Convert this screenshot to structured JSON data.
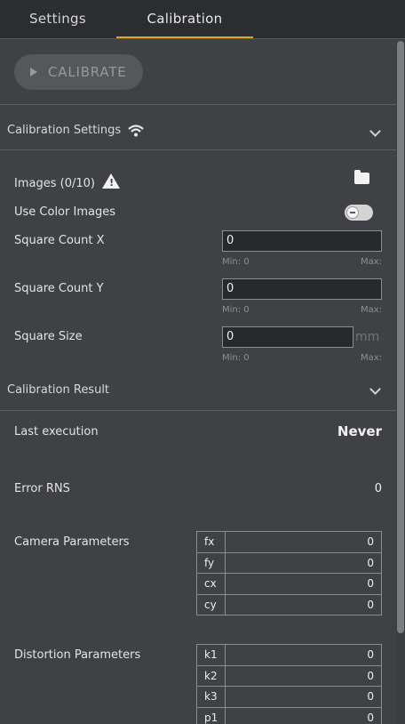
{
  "tabs": [
    {
      "label": "Settings",
      "active": false
    },
    {
      "label": "Calibration",
      "active": true
    }
  ],
  "calibrate_button": {
    "label": "CALIBRATE",
    "enabled": false
  },
  "calibration_settings": {
    "title": "Calibration Settings",
    "images_label": "Images (0/10)",
    "use_color_label": "Use Color Images",
    "use_color_on": false,
    "square_count_x": {
      "label": "Square Count X",
      "value": "0",
      "min": "Min: 0",
      "max": "Max:"
    },
    "square_count_y": {
      "label": "Square Count Y",
      "value": "0",
      "min": "Min: 0",
      "max": "Max:"
    },
    "square_size": {
      "label": "Square Size",
      "value": "0",
      "unit": "mm",
      "min": "Min: 0",
      "max": "Max:"
    }
  },
  "calibration_result": {
    "title": "Calibration Result",
    "last_execution_label": "Last execution",
    "last_execution_value": "Never",
    "error_rns_label": "Error RNS",
    "error_rns_value": "0",
    "camera_parameters_label": "Camera Parameters",
    "camera_parameters": [
      {
        "key": "fx",
        "value": "0"
      },
      {
        "key": "fy",
        "value": "0"
      },
      {
        "key": "cx",
        "value": "0"
      },
      {
        "key": "cy",
        "value": "0"
      }
    ],
    "distortion_parameters_label": "Distortion Parameters",
    "distortion_parameters": [
      {
        "key": "k1",
        "value": "0"
      },
      {
        "key": "k2",
        "value": "0"
      },
      {
        "key": "k3",
        "value": "0"
      },
      {
        "key": "p1",
        "value": "0"
      }
    ]
  },
  "colors": {
    "accent": "#e0a820",
    "background": "#3f4145",
    "tabbar": "#2b2d31"
  },
  "icons": [
    "play-icon",
    "wifi-icon",
    "chevron-down-icon",
    "warning-icon",
    "folder-icon"
  ]
}
